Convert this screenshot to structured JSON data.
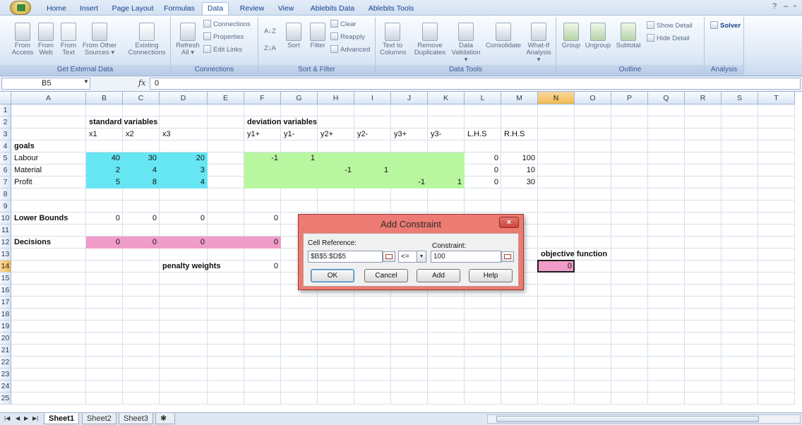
{
  "ribbon_tabs": [
    "Home",
    "Insert",
    "Page Layout",
    "Formulas",
    "Data",
    "Review",
    "View",
    "Ablebits Data",
    "Ablebits Tools"
  ],
  "active_tab": "Data",
  "window_controls": {
    "help": "?",
    "minimize": "–",
    "restore": "▫"
  },
  "ribbon": {
    "get_external_data": {
      "label": "Get External Data",
      "from_access": [
        "From",
        "Access"
      ],
      "from_web": [
        "From",
        "Web"
      ],
      "from_text": [
        "From",
        "Text"
      ],
      "from_other": [
        "From Other",
        "Sources ▾"
      ],
      "existing": [
        "Existing",
        "Connections"
      ]
    },
    "connections": {
      "label": "Connections",
      "refresh": [
        "Refresh",
        "All ▾"
      ],
      "connections": "Connections",
      "properties": "Properties",
      "edit_links": "Edit Links"
    },
    "sort_filter": {
      "label": "Sort & Filter",
      "az": "A↓Z",
      "za": "Z↓A",
      "sort": "Sort",
      "filter": "Filter",
      "clear": "Clear",
      "reapply": "Reapply",
      "advanced": "Advanced"
    },
    "data_tools": {
      "label": "Data Tools",
      "text_to_columns": [
        "Text to",
        "Columns"
      ],
      "remove_duplicates": [
        "Remove",
        "Duplicates"
      ],
      "data_validation": [
        "Data",
        "Validation ▾"
      ],
      "consolidate": "Consolidate",
      "what_if": [
        "What-If",
        "Analysis ▾"
      ]
    },
    "outline": {
      "label": "Outline",
      "group": "Group",
      "ungroup": "Ungroup",
      "subtotal": "Subtotal",
      "show_detail": "Show Detail",
      "hide_detail": "Hide Detail"
    },
    "analysis": {
      "label": "Analysis",
      "solver": "Solver"
    }
  },
  "formula_bar": {
    "name_box": "B5",
    "fx": "fx",
    "value": "0"
  },
  "columns": [
    "A",
    "B",
    "C",
    "D",
    "E",
    "F",
    "G",
    "H",
    "I",
    "J",
    "K",
    "L",
    "M",
    "N",
    "O",
    "P",
    "Q",
    "R",
    "S",
    "T"
  ],
  "selected_column": "N",
  "selected_row": "14",
  "rows": [
    "1",
    "2",
    "3",
    "4",
    "5",
    "6",
    "7",
    "8",
    "9",
    "10",
    "11",
    "12",
    "13",
    "14",
    "15",
    "16",
    "17",
    "18",
    "19",
    "20",
    "21",
    "22",
    "23",
    "24",
    "25"
  ],
  "cells": {
    "B2": "standard variables",
    "F2": "deviation variables",
    "B3": "x1",
    "C3": "x2",
    "D3": "x3",
    "F3": "y1+",
    "G3": "y1-",
    "H3": "y2+",
    "I3": "y2-",
    "J3": "y3+",
    "K3": "y3-",
    "L3": "L.H.S",
    "M3": "R.H.S",
    "A4": "goals",
    "A5": "Labour",
    "B5": "40",
    "C5": "30",
    "D5": "20",
    "F5": "-1",
    "G5": "1",
    "L5": "0",
    "M5": "100",
    "A6": "Material",
    "B6": "2",
    "C6": "4",
    "D6": "3",
    "H6": "-1",
    "I6": "1",
    "L6": "0",
    "M6": "10",
    "A7": "Profit",
    "B7": "5",
    "C7": "8",
    "D7": "4",
    "J7": "-1",
    "K7": "1",
    "L7": "0",
    "M7": "30",
    "A10": "Lower Bounds",
    "B10": "0",
    "C10": "0",
    "D10": "0",
    "F10": "0",
    "A12": "Decisions",
    "B12": "0",
    "C12": "0",
    "D12": "0",
    "F12": "0",
    "N13": "objective function",
    "D14": "penalty weights",
    "F14": "0",
    "N14": "0"
  },
  "fills": {
    "cyan": "#66e6f2",
    "green": "#b9f6a0",
    "pink": "#f09cc8"
  },
  "sheet_tabs": [
    "Sheet1",
    "Sheet2",
    "Sheet3"
  ],
  "active_sheet": "Sheet1",
  "dialog": {
    "title": "Add Constraint",
    "close": "×",
    "cell_reference_label": "Cell Reference:",
    "cell_reference_value": "$B$5:$D$5",
    "operator": "<=",
    "constraint_label": "Constraint:",
    "constraint_value": "100",
    "ok": "OK",
    "cancel": "Cancel",
    "add": "Add",
    "help": "Help"
  }
}
